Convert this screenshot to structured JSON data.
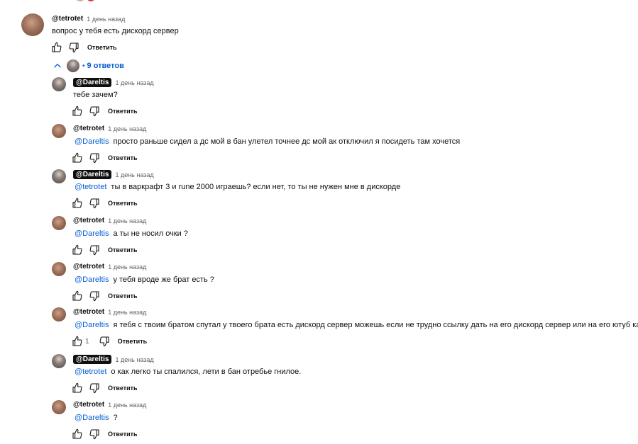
{
  "top_comment": {
    "author": "@tetrotet",
    "time": "1 день назад",
    "text": "вопрос у тебя есть дискорд сервер",
    "reply_label": "Ответить"
  },
  "replies_toggle": {
    "dot": "•",
    "count_label": "9 ответов",
    "color": "#065fd4"
  },
  "replies": [
    {
      "author": "@Dareltis",
      "owner": true,
      "time": "1 день назад",
      "mention": "",
      "text": "тебе зачем?",
      "likes": "",
      "reply_label": "Ответить"
    },
    {
      "author": "@tetrotet",
      "owner": false,
      "time": "1 день назад",
      "mention": "@Dareltis",
      "text": "просто раньше сидел а дс мой в бан улетел точнее дс мой ак отключил я  посидеть там хочется",
      "likes": "",
      "reply_label": "Ответить"
    },
    {
      "author": "@Dareltis",
      "owner": true,
      "time": "1 день назад",
      "mention": "@tetrotet",
      "text": "ты в варкрафт 3 и rune 2000 играешь? если нет, то ты не нужен мне в дискорде",
      "likes": "",
      "reply_label": "Ответить"
    },
    {
      "author": "@tetrotet",
      "owner": false,
      "time": "1 день назад",
      "mention": "@Dareltis",
      "text": "а ты не носил очки ?",
      "likes": "",
      "reply_label": "Ответить"
    },
    {
      "author": "@tetrotet",
      "owner": false,
      "time": "1 день назад",
      "mention": "@Dareltis",
      "text": "у тебя вроде же брат есть ?",
      "likes": "",
      "reply_label": "Ответить"
    },
    {
      "author": "@tetrotet",
      "owner": false,
      "time": "1 день назад",
      "mention": "@Dareltis",
      "text": "я тебя с твоим братом спутал у твоего брата есть дискорд сервер можешь если не трудно ссылку дать на его дискорд сервер  или на его ютуб канал",
      "likes": "1",
      "reply_label": "Ответить"
    },
    {
      "author": "@Dareltis",
      "owner": true,
      "time": "1 день назад",
      "mention": "@tetrotet",
      "text": "о как легко ты спалился, лети в бан отребье гнилое.",
      "likes": "",
      "reply_label": "Ответить"
    },
    {
      "author": "@tetrotet",
      "owner": false,
      "time": "1 день назад",
      "mention": "@Dareltis",
      "text": "?",
      "likes": "",
      "reply_label": "Ответить"
    }
  ],
  "icons": {
    "like": "thumbs-up-icon",
    "dislike": "thumbs-down-icon",
    "collapse": "chevron-up-icon"
  },
  "colors": {
    "mention": "#065fd4",
    "owner_chip": "#0f0f0f",
    "secondary_text": "#606060"
  }
}
